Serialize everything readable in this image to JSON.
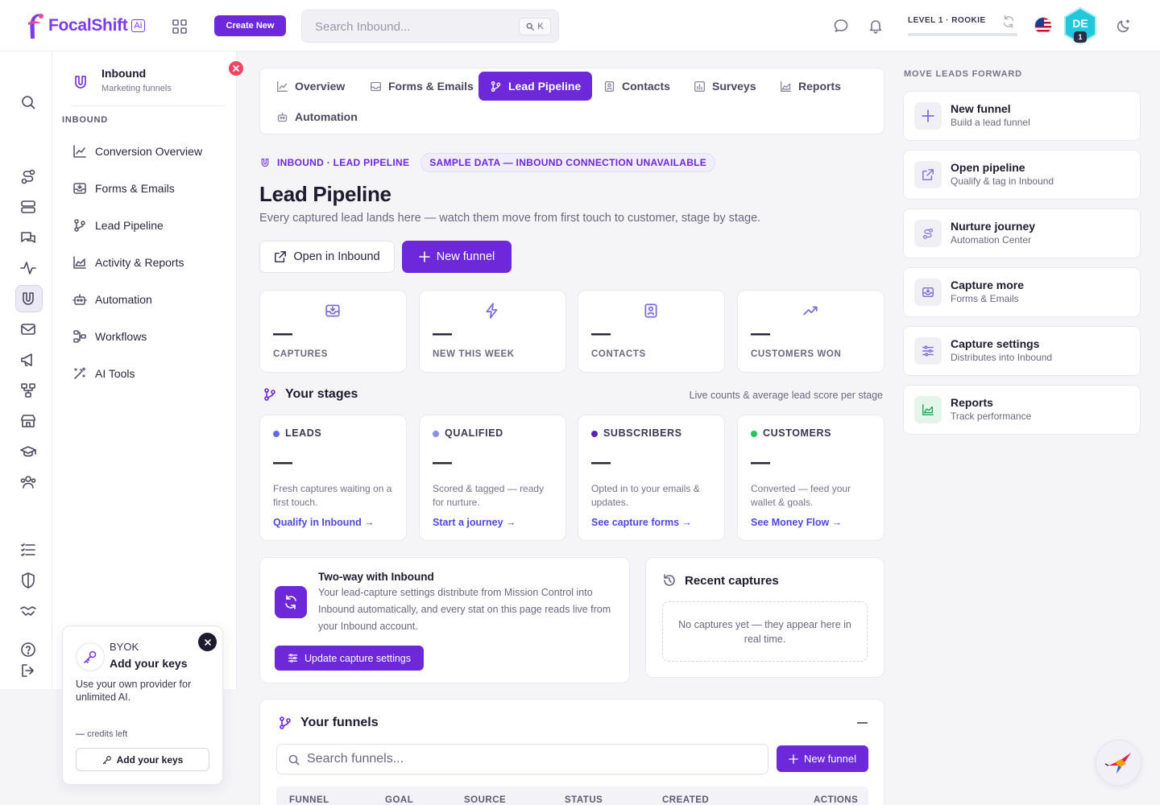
{
  "app": {
    "logo_text": "FocalShift",
    "logo_badge": "Ai",
    "create_label": "Create New",
    "search_placeholder": "Search Inbound...",
    "search_shortcut": "K",
    "level_label": "LEVEL 1 · ROOKIE",
    "level_progress": 0,
    "avatar_initials": "DE",
    "avatar_badge": "1",
    "accent_color": "#6d28d9"
  },
  "submenu": {
    "title": "Inbound",
    "subtitle": "Marketing funnels",
    "section_label": "INBOUND",
    "items": [
      {
        "label": "Conversion Overview",
        "icon": "trend-chart-icon"
      },
      {
        "label": "Forms & Emails",
        "icon": "inbox-icon"
      },
      {
        "label": "Lead Pipeline",
        "icon": "branch-icon"
      },
      {
        "label": "Activity & Reports",
        "icon": "area-chart-icon"
      },
      {
        "label": "Automation",
        "icon": "robot-icon"
      },
      {
        "label": "Workflows",
        "icon": "workflow-icon"
      },
      {
        "label": "AI Tools",
        "icon": "magic-wand-icon"
      }
    ]
  },
  "byok": {
    "tag": "BYOK",
    "title": "Add your keys",
    "description": "Use your own provider for unlimited AI.",
    "credits_value": "—",
    "credits_label": "credits left",
    "button_label": "Add your keys"
  },
  "tabs": [
    {
      "label": "Overview",
      "active": false
    },
    {
      "label": "Forms & Emails",
      "active": false
    },
    {
      "label": "Lead Pipeline",
      "active": true
    },
    {
      "label": "Contacts",
      "active": false
    },
    {
      "label": "Surveys",
      "active": false
    },
    {
      "label": "Reports",
      "active": false
    },
    {
      "label": "Automation",
      "active": false
    }
  ],
  "page": {
    "breadcrumb": "INBOUND · LEAD PIPELINE",
    "notice": "SAMPLE DATA — INBOUND CONNECTION UNAVAILABLE",
    "title": "Lead Pipeline",
    "description": "Every captured lead lands here — watch them move from first touch to customer, stage by stage.",
    "open_button": "Open in Inbound",
    "new_funnel_button": "New funnel"
  },
  "stats": [
    {
      "value": "—",
      "label": "CAPTURES",
      "icon": "inbox-icon"
    },
    {
      "value": "—",
      "label": "NEW THIS WEEK",
      "icon": "lightning-icon"
    },
    {
      "value": "—",
      "label": "CONTACTS",
      "icon": "contact-card-icon"
    },
    {
      "value": "—",
      "label": "CUSTOMERS WON",
      "icon": "trending-up-icon"
    }
  ],
  "stages_section": {
    "title": "Your stages",
    "note": "Live counts & average lead score per stage"
  },
  "stages": [
    {
      "name": "LEADS",
      "color": "#6366f1",
      "value": "—",
      "description": "Fresh captures waiting on a first touch.",
      "link": "Qualify in Inbound →"
    },
    {
      "name": "QUALIFIED",
      "color": "#8b8fe8",
      "value": "—",
      "description": "Scored & tagged — ready for nurture.",
      "link": "Start a journey →"
    },
    {
      "name": "SUBSCRIBERS",
      "color": "#5b21b6",
      "value": "—",
      "description": "Opted in to your emails & updates.",
      "link": "See capture forms →"
    },
    {
      "name": "CUSTOMERS",
      "color": "#22c55e",
      "value": "—",
      "description": "Converted — feed your wallet & goals.",
      "link": "See Money Flow →"
    }
  ],
  "sync": {
    "title": "Two-way with Inbound",
    "description": "Your lead-capture settings distribute from Mission Control into Inbound automatically, and every stat on this page reads live from your Inbound account.",
    "button": "Update capture settings"
  },
  "recent": {
    "title": "Recent captures",
    "empty": "No captures yet — they appear here in real time."
  },
  "funnels": {
    "title": "Your funnels",
    "search_placeholder": "Search funnels...",
    "new_button": "New funnel",
    "columns": [
      "FUNNEL",
      "GOAL",
      "SOURCE",
      "STATUS",
      "CREATED",
      "ACTIONS"
    ]
  },
  "right_panel": {
    "title": "MOVE LEADS FORWARD",
    "items": [
      {
        "label": "New funnel",
        "sub": "Build a lead funnel",
        "icon": "plus-icon"
      },
      {
        "label": "Open pipeline",
        "sub": "Qualify & tag in Inbound",
        "icon": "external-link-icon"
      },
      {
        "label": "Nurture journey",
        "sub": "Automation Center",
        "icon": "journey-icon"
      },
      {
        "label": "Capture more",
        "sub": "Forms & Emails",
        "icon": "inbox-icon"
      },
      {
        "label": "Capture settings",
        "sub": "Distributes into Inbound",
        "icon": "sliders-icon"
      },
      {
        "label": "Reports",
        "sub": "Track performance",
        "icon": "area-chart-icon"
      }
    ]
  }
}
